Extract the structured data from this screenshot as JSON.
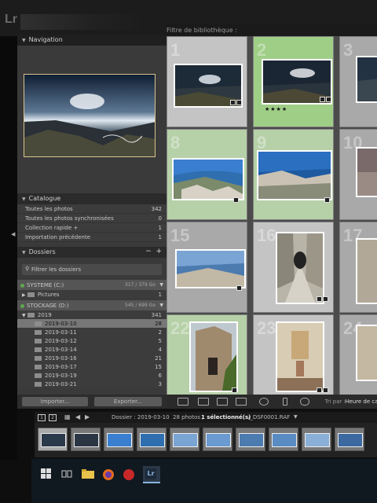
{
  "app": {
    "logo": "Lr"
  },
  "navigator": {
    "title": "Navigation"
  },
  "catalog": {
    "title": "Catalogue",
    "rows": [
      {
        "label": "Toutes les photos",
        "count": "342"
      },
      {
        "label": "Toutes les photos synchronisées",
        "count": "0"
      },
      {
        "label": "Collection rapide +",
        "count": "1"
      },
      {
        "label": "Importation précédente",
        "count": "1"
      }
    ]
  },
  "folders": {
    "title": "Dossiers",
    "plus": "+",
    "minus": "−",
    "filter_placeholder": "Filtrer les dossiers",
    "volumes": [
      {
        "name": "SYSTEME (C:)",
        "size": "317 / 379 Go"
      },
      {
        "name": "STOCKAGE (D:)",
        "size": "545 / 699 Go"
      }
    ],
    "pictures": {
      "label": "Pictures",
      "count": "1"
    },
    "year": {
      "label": "2019",
      "count": "341"
    },
    "days": [
      {
        "label": "2019-03-10",
        "count": "28"
      },
      {
        "label": "2019-03-11",
        "count": "2"
      },
      {
        "label": "2019-03-12",
        "count": "5"
      },
      {
        "label": "2019-03-14",
        "count": "4"
      },
      {
        "label": "2019-03-16",
        "count": "21"
      },
      {
        "label": "2019-03-17",
        "count": "15"
      },
      {
        "label": "2019-03-19",
        "count": "6"
      },
      {
        "label": "2019-03-21",
        "count": "3"
      }
    ],
    "import_btn": "Importer...",
    "export_btn": "Exporter..."
  },
  "library_filter": {
    "label": "Filtre de bibliothèque :"
  },
  "grid": {
    "cells": [
      {
        "num": "1"
      },
      {
        "num": "2",
        "stars": "★★★★"
      },
      {
        "num": "3"
      },
      {
        "num": "8"
      },
      {
        "num": "9"
      },
      {
        "num": "10"
      },
      {
        "num": "15"
      },
      {
        "num": "16"
      },
      {
        "num": "17"
      },
      {
        "num": "22"
      },
      {
        "num": "23"
      },
      {
        "num": "24"
      }
    ]
  },
  "toolbar": {
    "sort_label": "Tri par :",
    "sort_value": "Heure de cap"
  },
  "filmstrip_bar": {
    "view1": "1",
    "view2": "2",
    "source": "Dossier : 2019-03-10",
    "count_prefix": "28 photos /",
    "selected": "1 sélectionné(s)",
    "filename": "/_DSF0001.RAF"
  },
  "colors": {
    "accent_green": "#9fce86",
    "panel": "#3a3a3a",
    "selection": "#d8c38e"
  }
}
